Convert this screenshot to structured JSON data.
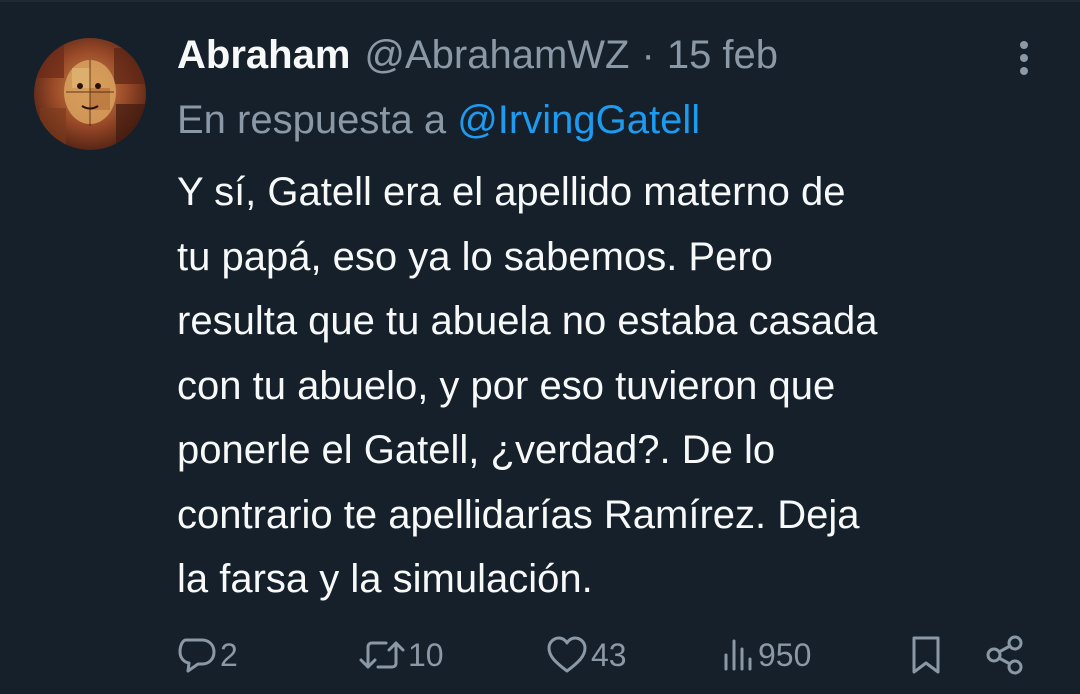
{
  "tweet": {
    "author": {
      "display_name": "Abraham",
      "handle": "@AbrahamWZ",
      "avatar_icon": "avatar-painting"
    },
    "separator": "·",
    "date": "15 feb",
    "reply_prefix": "En respuesta a",
    "reply_mention": "@IrvingGatell",
    "text_lines": [
      "Y sí, Gatell era el apellido materno de",
      "tu papá, eso ya lo sabemos. Pero",
      "resulta que tu abuela no estaba casada",
      "con tu abuelo, y por eso tuvieron que",
      "ponerle el Gatell, ¿verdad?. De lo",
      "contrario te apellidarías Ramírez. Deja",
      "la farsa y la simulación."
    ],
    "actions": {
      "replies": "2",
      "retweets": "10",
      "likes": "43",
      "views": "950"
    },
    "icons": {
      "more": "more-vertical-icon",
      "reply": "reply-icon",
      "retweet": "retweet-icon",
      "like": "heart-icon",
      "views": "views-icon",
      "bookmark": "bookmark-icon",
      "share": "share-icon"
    }
  },
  "colors": {
    "background": "#15202b",
    "primary_text": "#f7f9f9",
    "secondary_text": "#8b98a5",
    "accent": "#1d9bf0"
  }
}
